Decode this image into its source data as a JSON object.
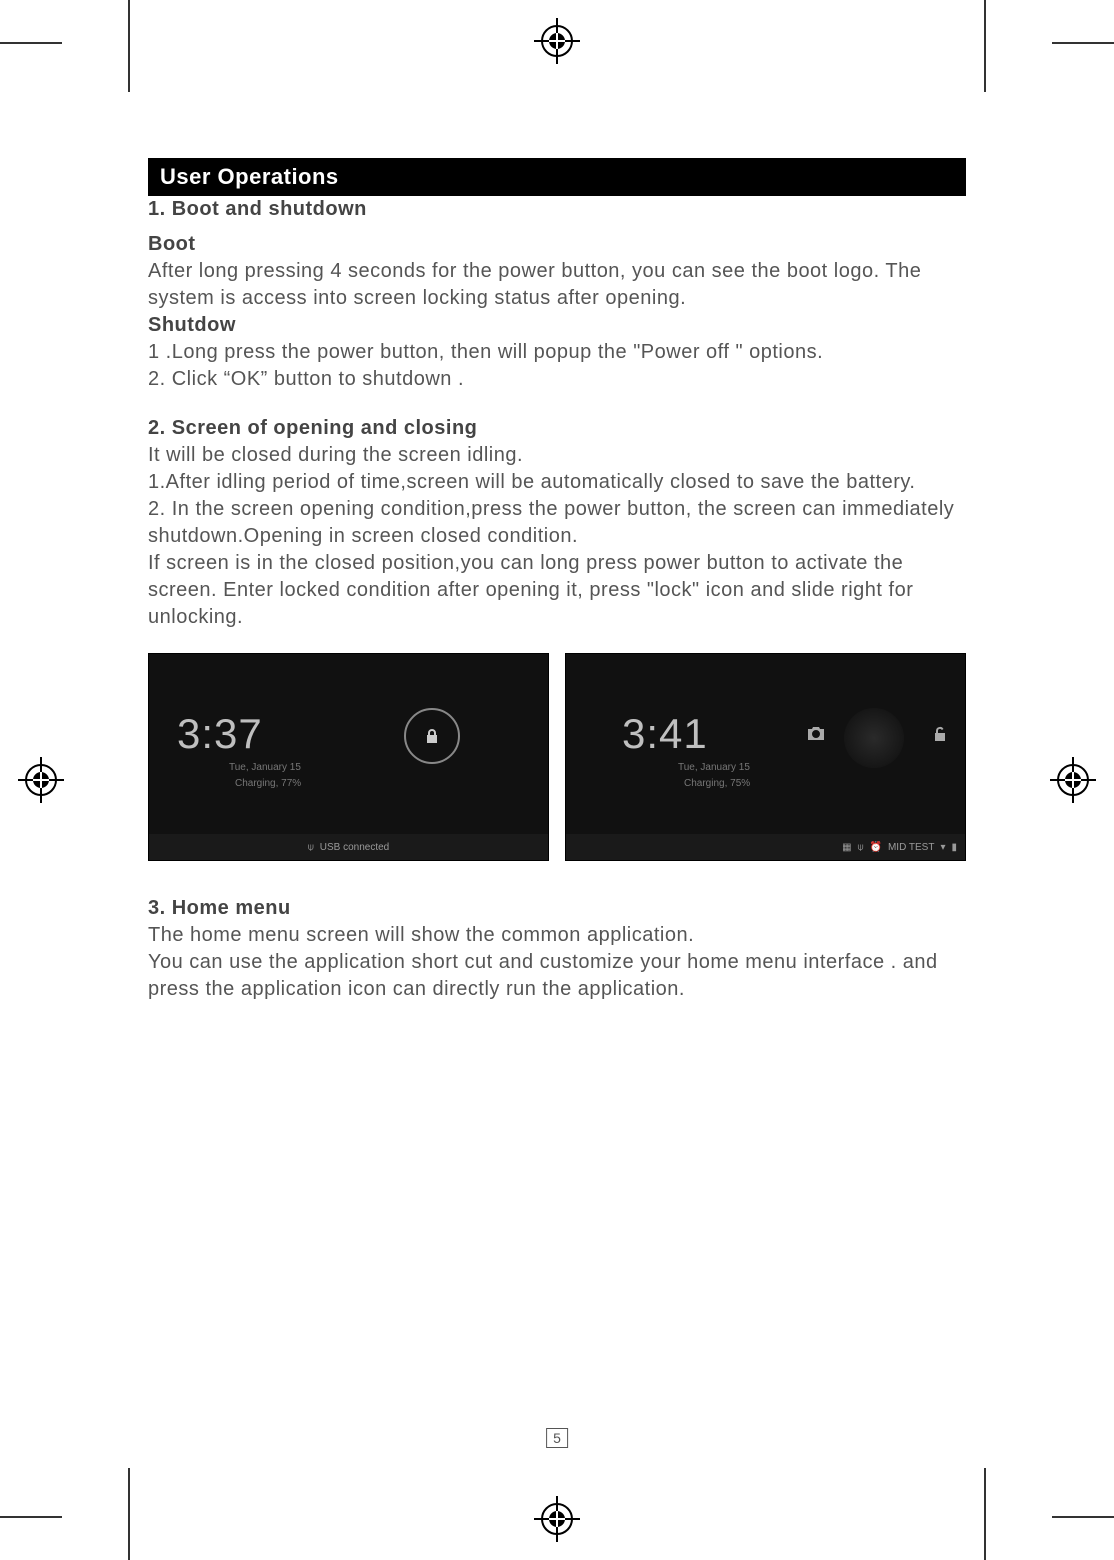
{
  "section_title": "User Operations",
  "s1": {
    "heading": "1. Boot and shutdown",
    "boot_h": "Boot",
    "boot_p": "After  long pressing 4 seconds for the power button, you can see the boot logo. The system  is access into screen locking status after opening.",
    "shutdown_h": "Shutdow",
    "shutdown_p1": "1 .Long  press  the power button, then will popup  the  \"Power off \" options.",
    "shutdown_p2": "2. Click  “OK” button  to shutdown ."
  },
  "s2": {
    "heading": "2. Screen of  opening  and  closing",
    "p1": "It will be closed during the screen idling.",
    "p2": "1.After  idling period of  time,screen will be automatically  closed to save the battery.",
    "p3": "2. In the screen opening condition,press the  power button, the screen can immediately shutdown.Opening in  screen closed  condition.",
    "p4": "If screen is in the closed position,you can long press power button to activate the screen. Enter  locked condition after  opening  it,  press \"lock\" icon and slide right for unlocking."
  },
  "shot1": {
    "time": "3:37",
    "date": "Tue, January 15",
    "charge": "Charging, 77%",
    "status": "USB connected"
  },
  "shot2": {
    "time": "3:41",
    "date": "Tue, January 15",
    "charge": "Charging, 75%",
    "status": "MID TEST"
  },
  "s3": {
    "heading": "3. Home menu",
    "p1": "The home menu screen will show the common  application.",
    "p2": "You  can  use  the   application short cut  and  customize  your home menu  interface . and  press the application  icon can directly  run  the application."
  },
  "page_number": "5"
}
